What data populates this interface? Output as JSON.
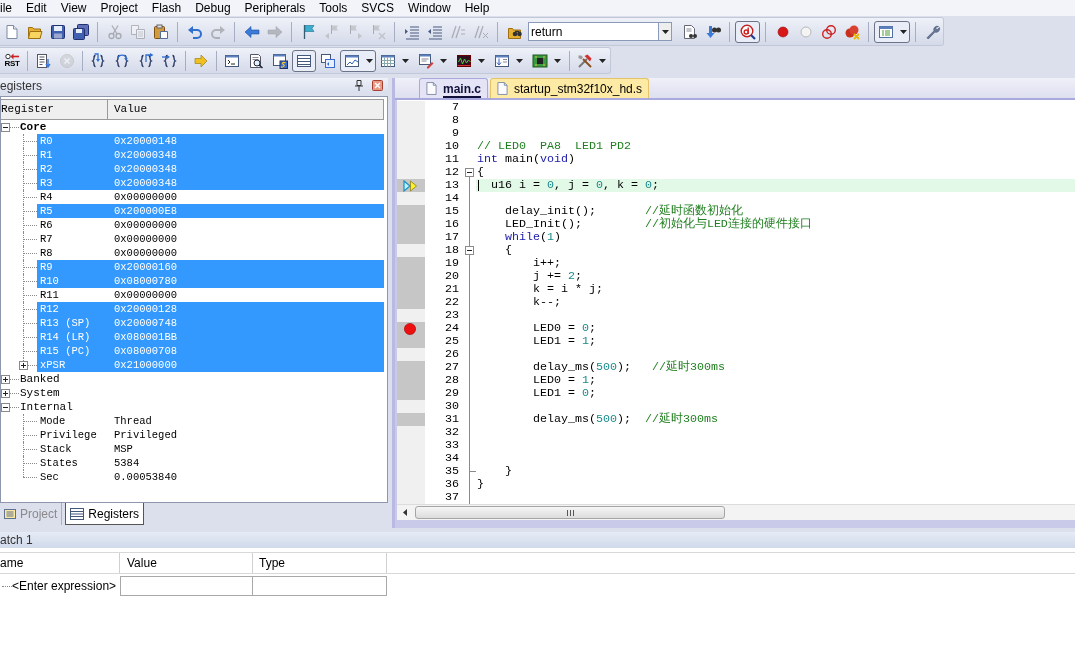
{
  "menu": {
    "items": [
      "ile",
      "Edit",
      "View",
      "Project",
      "Flash",
      "Debug",
      "Peripherals",
      "Tools",
      "SVCS",
      "Window",
      "Help"
    ]
  },
  "toolbar_1": {
    "groups": [
      {
        "buttons": [
          {
            "disabled": false,
            "pressed": false
          },
          {
            "disabled": false,
            "pressed": false
          },
          {
            "disabled": false,
            "pressed": false
          },
          {
            "disabled": false,
            "pressed": false
          }
        ]
      },
      {
        "buttons": [
          {
            "disabled": true,
            "pressed": false
          },
          {
            "disabled": true,
            "pressed": false
          },
          {
            "disabled": false,
            "pressed": false
          }
        ]
      },
      {
        "buttons": [
          {
            "disabled": false,
            "pressed": false
          },
          {
            "disabled": true,
            "pressed": false
          }
        ]
      },
      {
        "buttons": [
          {
            "disabled": false,
            "pressed": false
          },
          {
            "disabled": true,
            "pressed": false
          }
        ]
      },
      {
        "buttons": [
          {
            "disabled": false,
            "pressed": false
          },
          {
            "disabled": true,
            "pressed": false
          },
          {
            "disabled": true,
            "pressed": false
          },
          {
            "disabled": true,
            "pressed": false
          }
        ]
      },
      {
        "buttons": [
          {
            "disabled": false,
            "pressed": false
          },
          {
            "disabled": false,
            "pressed": false
          },
          {
            "disabled": true,
            "pressed": false
          },
          {
            "disabled": true,
            "pressed": false
          }
        ]
      },
      {
        "buttons": [
          {
            "kind": "button",
            "disabled": false,
            "pressed": false
          },
          {
            "kind": "combo",
            "value": "return"
          },
          {
            "kind": "button",
            "disabled": false,
            "pressed": false
          },
          {
            "kind": "button",
            "disabled": false,
            "pressed": false
          }
        ]
      },
      {
        "buttons": [
          {
            "disabled": false,
            "pressed": true
          }
        ]
      },
      {
        "buttons": [
          {
            "disabled": false,
            "pressed": false
          },
          {
            "disabled": false,
            "pressed": false
          },
          {
            "disabled": false,
            "pressed": false
          },
          {
            "disabled": false,
            "pressed": false
          }
        ]
      },
      {
        "buttons": [
          {
            "disabled": false,
            "pressed": true
          }
        ]
      },
      {
        "buttons": [
          {
            "disabled": false,
            "pressed": false
          }
        ]
      }
    ]
  },
  "toolbar_2": {
    "groups": [
      {
        "buttons": [
          {
            "label": "RST",
            "disabled": false,
            "pressed": false
          }
        ]
      },
      {
        "buttons": [
          {
            "disabled": false,
            "pressed": false
          },
          {
            "disabled": true,
            "pressed": false
          }
        ]
      },
      {
        "buttons": [
          {
            "disabled": false,
            "pressed": false
          },
          {
            "disabled": false,
            "pressed": false
          },
          {
            "disabled": false,
            "pressed": false
          },
          {
            "disabled": false,
            "pressed": false
          }
        ]
      },
      {
        "buttons": [
          {
            "disabled": false,
            "pressed": false
          }
        ]
      },
      {
        "buttons": [
          {
            "disabled": false,
            "pressed": false
          },
          {
            "disabled": false,
            "pressed": false
          },
          {
            "disabled": false,
            "pressed": false
          },
          {
            "disabled": false,
            "pressed": true
          },
          {
            "disabled": false,
            "pressed": false
          },
          {
            "disabled": false,
            "pressed": true
          },
          {
            "disabled": false,
            "pressed": false
          },
          {
            "disabled": false,
            "pressed": false
          },
          {
            "disabled": false,
            "pressed": false
          },
          {
            "disabled": false,
            "pressed": false
          },
          {
            "disabled": false,
            "pressed": false
          }
        ]
      },
      {
        "buttons": [
          {
            "disabled": false,
            "pressed": false
          }
        ]
      }
    ]
  },
  "registers_panel": {
    "title": "egisters",
    "columns": [
      "Register",
      "Value"
    ],
    "tree": [
      {
        "name": "Core",
        "bold": true,
        "expanded": true,
        "children": [
          {
            "name": "R0",
            "value": "0x20000148",
            "changed": true
          },
          {
            "name": "R1",
            "value": "0x20000348",
            "changed": true
          },
          {
            "name": "R2",
            "value": "0x20000348",
            "changed": true
          },
          {
            "name": "R3",
            "value": "0x20000348",
            "changed": true
          },
          {
            "name": "R4",
            "value": "0x00000000",
            "changed": false
          },
          {
            "name": "R5",
            "value": "0x200000E8",
            "changed": true
          },
          {
            "name": "R6",
            "value": "0x00000000",
            "changed": false
          },
          {
            "name": "R7",
            "value": "0x00000000",
            "changed": false
          },
          {
            "name": "R8",
            "value": "0x00000000",
            "changed": false
          },
          {
            "name": "R9",
            "value": "0x20000160",
            "changed": true
          },
          {
            "name": "R10",
            "value": "0x08000780",
            "changed": true
          },
          {
            "name": "R11",
            "value": "0x00000000",
            "changed": false
          },
          {
            "name": "R12",
            "value": "0x20000128",
            "changed": true
          },
          {
            "name": "R13 (SP)",
            "value": "0x20000748",
            "changed": true
          },
          {
            "name": "R14 (LR)",
            "value": "0x080001BB",
            "changed": true
          },
          {
            "name": "R15 (PC)",
            "value": "0x08000708",
            "changed": true
          },
          {
            "name": "xPSR",
            "value": "0x21000000",
            "changed": true,
            "expanded": false
          }
        ]
      },
      {
        "name": "Banked",
        "bold": false,
        "expanded": false
      },
      {
        "name": "System",
        "bold": false,
        "expanded": false
      },
      {
        "name": "Internal",
        "bold": false,
        "expanded": true,
        "children": [
          {
            "name": "Mode",
            "value": "Thread",
            "changed": false
          },
          {
            "name": "Privilege",
            "value": "Privileged",
            "changed": false
          },
          {
            "name": "Stack",
            "value": "MSP",
            "changed": false
          },
          {
            "name": "States",
            "value": "5384",
            "changed": false
          },
          {
            "name": "Sec",
            "value": "0.00053840",
            "changed": false
          }
        ]
      }
    ],
    "tabs": [
      {
        "label": "Project",
        "selected": false
      },
      {
        "label": "Registers",
        "selected": true
      }
    ]
  },
  "editor": {
    "tabs": [
      {
        "label": "main.c",
        "selected": true
      },
      {
        "label": "startup_stm32f10x_hd.s",
        "selected": false
      }
    ],
    "lines": [
      {
        "number": "7",
        "executable": false,
        "current": false,
        "breakpoint": false,
        "cursor": false,
        "fold_start": false,
        "fold_end": false
      },
      {
        "number": "8",
        "executable": false,
        "current": false,
        "breakpoint": false,
        "cursor": false,
        "fold_start": false,
        "fold_end": false
      },
      {
        "number": "9",
        "executable": false,
        "current": false,
        "breakpoint": false,
        "cursor": false,
        "fold_start": false,
        "fold_end": false
      },
      {
        "number": "10",
        "executable": false,
        "current": false,
        "breakpoint": false,
        "cursor": false,
        "fold_start": false,
        "fold_end": false,
        "tokens": [
          {
            "text": "// LED0  PA8  LED1 PD2",
            "kind": "comment"
          }
        ]
      },
      {
        "number": "11",
        "executable": false,
        "current": false,
        "breakpoint": false,
        "cursor": false,
        "fold_start": false,
        "fold_end": false,
        "tokens": [
          {
            "text": "int",
            "kind": "keyword"
          },
          {
            "text": " main(",
            "kind": "plain"
          },
          {
            "text": "void",
            "kind": "keyword"
          },
          {
            "text": ")",
            "kind": "plain"
          }
        ]
      },
      {
        "number": "12",
        "executable": false,
        "current": false,
        "breakpoint": false,
        "cursor": false,
        "fold_start": true,
        "fold_end": false,
        "tokens": [
          {
            "text": "{",
            "kind": "plain"
          }
        ]
      },
      {
        "number": "13",
        "executable": true,
        "current": true,
        "breakpoint": false,
        "cursor": true,
        "fold_start": false,
        "fold_end": false,
        "tokens": [
          {
            "text": "  u16 i = ",
            "kind": "plain"
          },
          {
            "text": "0",
            "kind": "number"
          },
          {
            "text": ", j = ",
            "kind": "plain"
          },
          {
            "text": "0",
            "kind": "number"
          },
          {
            "text": ", k = ",
            "kind": "plain"
          },
          {
            "text": "0",
            "kind": "number"
          },
          {
            "text": ";",
            "kind": "plain"
          }
        ]
      },
      {
        "number": "14",
        "executable": false,
        "current": false,
        "breakpoint": false,
        "cursor": false,
        "fold_start": false,
        "fold_end": false
      },
      {
        "number": "15",
        "executable": true,
        "current": false,
        "breakpoint": false,
        "cursor": false,
        "fold_start": false,
        "fold_end": false,
        "tokens": [
          {
            "text": "    delay_init();       ",
            "kind": "plain"
          },
          {
            "text": "//延时函数初始化",
            "kind": "comment"
          }
        ]
      },
      {
        "number": "16",
        "executable": true,
        "current": false,
        "breakpoint": false,
        "cursor": false,
        "fold_start": false,
        "fold_end": false,
        "tokens": [
          {
            "text": "    LED_Init();         ",
            "kind": "plain"
          },
          {
            "text": "//初始化与LED连接的硬件接口",
            "kind": "comment"
          }
        ]
      },
      {
        "number": "17",
        "executable": true,
        "current": false,
        "breakpoint": false,
        "cursor": false,
        "fold_start": false,
        "fold_end": false,
        "tokens": [
          {
            "text": "    while",
            "kind": "keyword"
          },
          {
            "text": "(",
            "kind": "plain"
          },
          {
            "text": "1",
            "kind": "number"
          },
          {
            "text": ")",
            "kind": "plain"
          }
        ]
      },
      {
        "number": "18",
        "executable": false,
        "current": false,
        "breakpoint": false,
        "cursor": false,
        "fold_start": true,
        "fold_end": false,
        "tokens": [
          {
            "text": "    {",
            "kind": "plain"
          }
        ]
      },
      {
        "number": "19",
        "executable": true,
        "current": false,
        "breakpoint": false,
        "cursor": false,
        "fold_start": false,
        "fold_end": false,
        "tokens": [
          {
            "text": "        i++;",
            "kind": "plain"
          }
        ]
      },
      {
        "number": "20",
        "executable": true,
        "current": false,
        "breakpoint": false,
        "cursor": false,
        "fold_start": false,
        "fold_end": false,
        "tokens": [
          {
            "text": "        j += ",
            "kind": "plain"
          },
          {
            "text": "2",
            "kind": "number"
          },
          {
            "text": ";",
            "kind": "plain"
          }
        ]
      },
      {
        "number": "21",
        "executable": true,
        "current": false,
        "breakpoint": false,
        "cursor": false,
        "fold_start": false,
        "fold_end": false,
        "tokens": [
          {
            "text": "        k = i * j;",
            "kind": "plain"
          }
        ]
      },
      {
        "number": "22",
        "executable": true,
        "current": false,
        "breakpoint": false,
        "cursor": false,
        "fold_start": false,
        "fold_end": false,
        "tokens": [
          {
            "text": "        k--;",
            "kind": "plain"
          }
        ]
      },
      {
        "number": "23",
        "executable": false,
        "current": false,
        "breakpoint": false,
        "cursor": false,
        "fold_start": false,
        "fold_end": false
      },
      {
        "number": "24",
        "executable": true,
        "current": false,
        "breakpoint": true,
        "cursor": false,
        "fold_start": false,
        "fold_end": false,
        "tokens": [
          {
            "text": "        LED0 = ",
            "kind": "plain"
          },
          {
            "text": "0",
            "kind": "number"
          },
          {
            "text": ";",
            "kind": "plain"
          }
        ]
      },
      {
        "number": "25",
        "executable": true,
        "current": false,
        "breakpoint": false,
        "cursor": false,
        "fold_start": false,
        "fold_end": false,
        "tokens": [
          {
            "text": "        LED1 = ",
            "kind": "plain"
          },
          {
            "text": "1",
            "kind": "number"
          },
          {
            "text": ";",
            "kind": "plain"
          }
        ]
      },
      {
        "number": "26",
        "executable": false,
        "current": false,
        "breakpoint": false,
        "cursor": false,
        "fold_start": false,
        "fold_end": false
      },
      {
        "number": "27",
        "executable": true,
        "current": false,
        "breakpoint": false,
        "cursor": false,
        "fold_start": false,
        "fold_end": false,
        "tokens": [
          {
            "text": "        delay_ms(",
            "kind": "plain"
          },
          {
            "text": "500",
            "kind": "number"
          },
          {
            "text": ");   ",
            "kind": "plain"
          },
          {
            "text": "//延时300ms",
            "kind": "comment"
          }
        ]
      },
      {
        "number": "28",
        "executable": true,
        "current": false,
        "breakpoint": false,
        "cursor": false,
        "fold_start": false,
        "fold_end": false,
        "tokens": [
          {
            "text": "        LED0 = ",
            "kind": "plain"
          },
          {
            "text": "1",
            "kind": "number"
          },
          {
            "text": ";",
            "kind": "plain"
          }
        ]
      },
      {
        "number": "29",
        "executable": true,
        "current": false,
        "breakpoint": false,
        "cursor": false,
        "fold_start": false,
        "fold_end": false,
        "tokens": [
          {
            "text": "        LED1 = ",
            "kind": "plain"
          },
          {
            "text": "0",
            "kind": "number"
          },
          {
            "text": ";",
            "kind": "plain"
          }
        ]
      },
      {
        "number": "30",
        "executable": false,
        "current": false,
        "breakpoint": false,
        "cursor": false,
        "fold_start": false,
        "fold_end": false
      },
      {
        "number": "31",
        "executable": true,
        "current": false,
        "breakpoint": false,
        "cursor": false,
        "fold_start": false,
        "fold_end": false,
        "tokens": [
          {
            "text": "        delay_ms(",
            "kind": "plain"
          },
          {
            "text": "500",
            "kind": "number"
          },
          {
            "text": ");  ",
            "kind": "plain"
          },
          {
            "text": "//延时300ms",
            "kind": "comment"
          }
        ]
      },
      {
        "number": "32",
        "executable": false,
        "current": false,
        "breakpoint": false,
        "cursor": false,
        "fold_start": false,
        "fold_end": false
      },
      {
        "number": "33",
        "executable": false,
        "current": false,
        "breakpoint": false,
        "cursor": false,
        "fold_start": false,
        "fold_end": false
      },
      {
        "number": "34",
        "executable": false,
        "current": false,
        "breakpoint": false,
        "cursor": false,
        "fold_start": false,
        "fold_end": false
      },
      {
        "number": "35",
        "executable": false,
        "current": false,
        "breakpoint": false,
        "cursor": false,
        "fold_start": false,
        "fold_end": true,
        "tokens": [
          {
            "text": "    }",
            "kind": "plain"
          }
        ]
      },
      {
        "number": "36",
        "executable": false,
        "current": false,
        "breakpoint": false,
        "cursor": false,
        "fold_start": false,
        "fold_end": false,
        "tokens": [
          {
            "text": "}",
            "kind": "plain"
          }
        ]
      },
      {
        "number": "37",
        "executable": false,
        "current": false,
        "breakpoint": false,
        "cursor": false,
        "fold_start": false,
        "fold_end": false
      }
    ]
  },
  "watch_panel": {
    "title": "atch 1",
    "columns": [
      "ame",
      "Value",
      "Type"
    ],
    "rows": [
      {
        "expression": "<Enter expression>"
      }
    ]
  }
}
